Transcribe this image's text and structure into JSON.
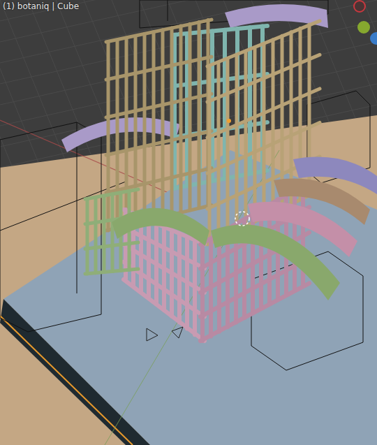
{
  "viewport": {
    "header": "(1) botaniq | Cube"
  },
  "gizmo": [
    {
      "kind": "ring",
      "color": "#c8383f"
    },
    {
      "kind": "filled",
      "color": "#86a82f"
    },
    {
      "kind": "filled",
      "color": "#3a7cc8"
    }
  ]
}
